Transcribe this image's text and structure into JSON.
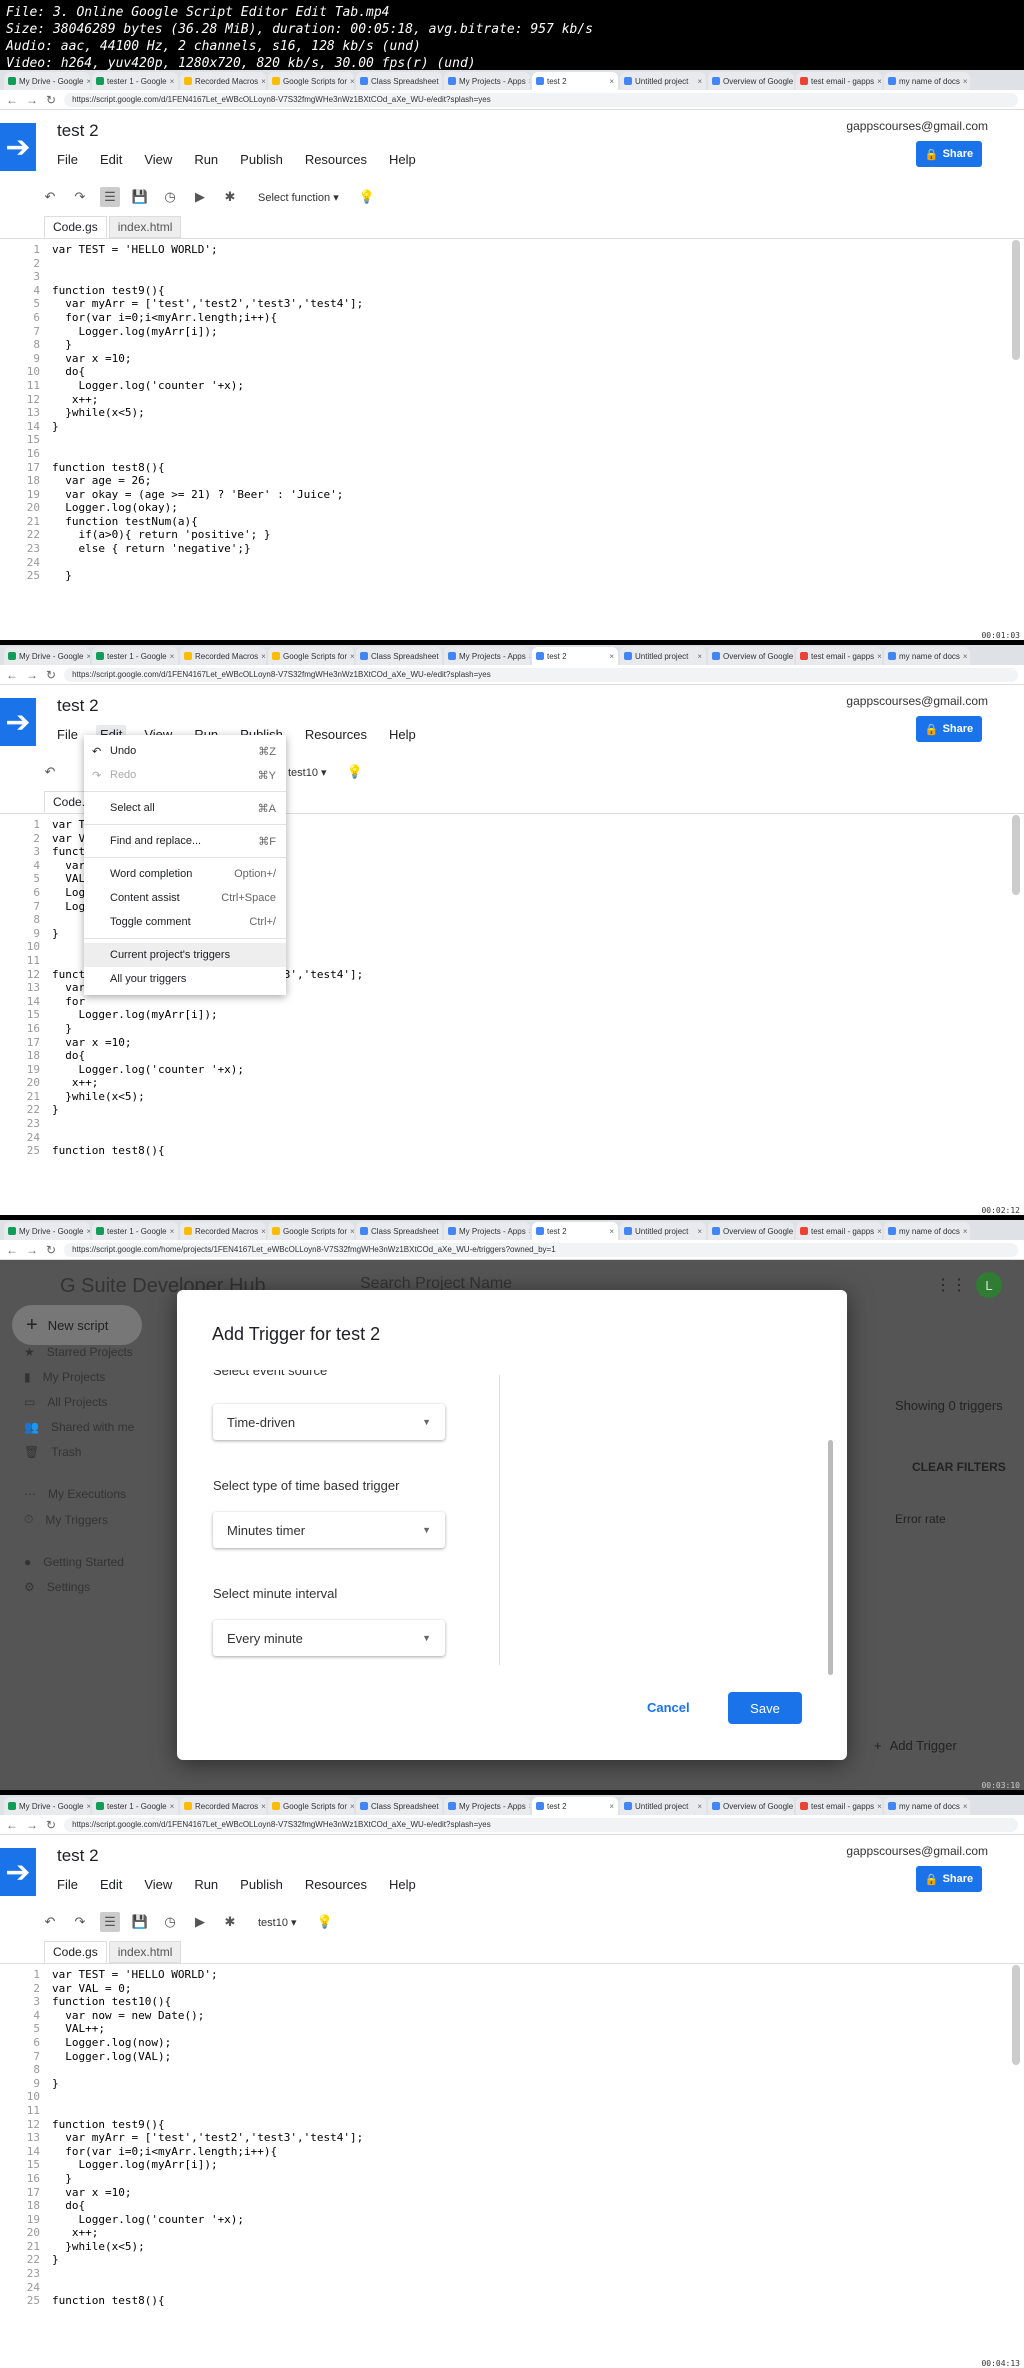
{
  "info": {
    "line1": "File: 3. Online Google Script Editor Edit Tab.mp4",
    "line2": "Size: 38046289 bytes (36.28 MiB), duration: 00:05:18, avg.bitrate: 957 kb/s",
    "line3": "Audio: aac, 44100 Hz, 2 channels, s16, 128 kb/s (und)",
    "line4": "Video: h264, yuv420p, 1280x720, 820 kb/s, 30.00 fps(r) (und)"
  },
  "browser": {
    "tabs": [
      "My Drive - Google",
      "tester 1 - Google",
      "Recorded Macros",
      "Google Scripts for",
      "Class Spreadsheet",
      "My Projects - Apps",
      "test 2",
      "Untitled project",
      "Overview of Google",
      "test email - gapps",
      "my name of docs"
    ],
    "url1": "https://script.google.com/d/1FEN4167Let_eWBcOLLoyn8-V7S32fmgWHe3nWz1BXtCOd_aXe_WU-e/edit?splash=yes",
    "url2": "https://script.google.com/home/projects/1FEN4167Let_eWBcOLLoyn8-V7S32fmgWHe3nWz1BXtCOd_aXe_WU-e/triggers?owned_by=1"
  },
  "editor": {
    "project_title": "test 2",
    "menu": [
      "File",
      "Edit",
      "View",
      "Run",
      "Publish",
      "Resources",
      "Help"
    ],
    "account": "gappscourses@gmail.com",
    "share_label": "Share",
    "select_function": "Select function",
    "test10": "test10",
    "file_tabs": [
      "Code.gs",
      "index.html"
    ]
  },
  "frame1_code": [
    "var TEST = 'HELLO WORLD';",
    "",
    "",
    "function test9(){",
    "  var myArr = ['test','test2','test3','test4'];",
    "  for(var i=0;i<myArr.length;i++){",
    "    Logger.log(myArr[i]);",
    "  }",
    "  var x =10;",
    "  do{",
    "    Logger.log('counter '+x);",
    "   x++;",
    "  }while(x<5);",
    "}",
    "",
    "",
    "function test8(){",
    "  var age = 26;",
    "  var okay = (age >= 21) ? 'Beer' : 'Juice';",
    "  Logger.log(okay);",
    "  function testNum(a){",
    "    if(a>0){ return 'positive'; }",
    "    else { return 'negative';}",
    "",
    "  }"
  ],
  "frame2_code": [
    "var T",
    "var V",
    "funct",
    "  var",
    "  VAL",
    "  Logg",
    "  Logg",
    "",
    "}",
    "",
    "",
    "funct                              3','test4'];",
    "  var",
    "  for",
    "    Logger.log(myArr[i]);",
    "  }",
    "  var x =10;",
    "  do{",
    "    Logger.log('counter '+x);",
    "   x++;",
    "  }while(x<5);",
    "}",
    "",
    "",
    "function test8(){"
  ],
  "edit_menu": {
    "items": [
      {
        "label": "Undo",
        "shortcut": "⌘Z",
        "icon": "undo-icon"
      },
      {
        "label": "Redo",
        "shortcut": "⌘Y",
        "icon": "redo-icon",
        "disabled": true
      },
      {
        "sep": true
      },
      {
        "label": "Select all",
        "shortcut": "⌘A"
      },
      {
        "sep": true
      },
      {
        "label": "Find and replace...",
        "shortcut": "⌘F"
      },
      {
        "sep": true
      },
      {
        "label": "Word completion",
        "shortcut": "Option+/"
      },
      {
        "label": "Content assist",
        "shortcut": "Ctrl+Space"
      },
      {
        "label": "Toggle comment",
        "shortcut": "Ctrl+/"
      },
      {
        "sep": true
      },
      {
        "label": "Current project's triggers",
        "shortcut": "",
        "highlight": true
      },
      {
        "label": "All your triggers",
        "shortcut": ""
      }
    ]
  },
  "hub": {
    "title": "G Suite Developer Hub",
    "search": "Search Project Name",
    "new_script": "New script",
    "sidebar": [
      "Starred Projects",
      "My Projects",
      "All Projects",
      "Shared with me",
      "Trash",
      "My Executions",
      "My Triggers",
      "Getting Started",
      "Settings"
    ],
    "showing": "Showing 0 triggers",
    "clear_filters": "CLEAR FILTERS",
    "error_rate": "Error rate",
    "add_trigger": "Add Trigger",
    "avatar": "L"
  },
  "modal": {
    "title": "Add Trigger for test 2",
    "event_source_label": "Select event source",
    "event_source_value": "Time-driven",
    "type_label": "Select type of time based trigger",
    "type_value": "Minutes timer",
    "interval_label": "Select minute interval",
    "interval_value": "Every minute",
    "cancel": "Cancel",
    "save": "Save"
  },
  "frame4_code": [
    "var TEST = 'HELLO WORLD';",
    "var VAL = 0;",
    "function test10(){",
    "  var now = new Date();",
    "  VAL++;",
    "  Logger.log(now);",
    "  Logger.log(VAL);",
    "",
    "}",
    "",
    "",
    "function test9(){",
    "  var myArr = ['test','test2','test3','test4'];",
    "  for(var i=0;i<myArr.length;i++){",
    "    Logger.log(myArr[i]);",
    "  }",
    "  var x =10;",
    "  do{",
    "    Logger.log('counter '+x);",
    "   x++;",
    "  }while(x<5);",
    "}",
    "",
    "",
    "function test8(){"
  ],
  "timestamps": [
    "00:01:03",
    "00:02:12",
    "00:03:10",
    "00:04:13"
  ]
}
